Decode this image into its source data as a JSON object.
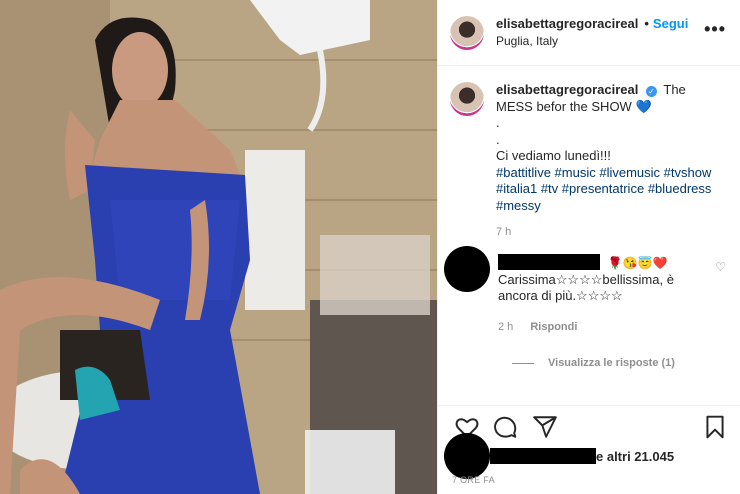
{
  "header": {
    "username": "elisabettagregoracireal",
    "separator": "•",
    "follow_label": "Segui",
    "location": "Puglia, Italy",
    "more_label": "•••"
  },
  "caption": {
    "username": "elisabettagregoracireal",
    "line1": "The MESS befor the SHOW",
    "heart": "💙",
    "dot1": ".",
    "dot2": ".",
    "line2": "Ci vediamo lunedì!!!",
    "hashtags": [
      "#battitlive",
      "#music",
      "#livemusic",
      "#tvshow",
      "#italia1",
      "#tv",
      "#presentatrice",
      "#bluedress",
      "#messy"
    ],
    "time": "7 h"
  },
  "comment": {
    "emojis": "🌹😘😇❤️",
    "text": "Carissima☆☆☆☆bellissima, è ancora di più.☆☆☆☆",
    "time": "2 h",
    "reply_label": "Rispondi",
    "view_replies": "Visualizza le risposte (1)"
  },
  "likes": {
    "text": "e altri 21.045"
  },
  "posted": "7 ORE FA",
  "colors": {
    "accent": "#0095f6",
    "dress": "#2a3fb0"
  }
}
